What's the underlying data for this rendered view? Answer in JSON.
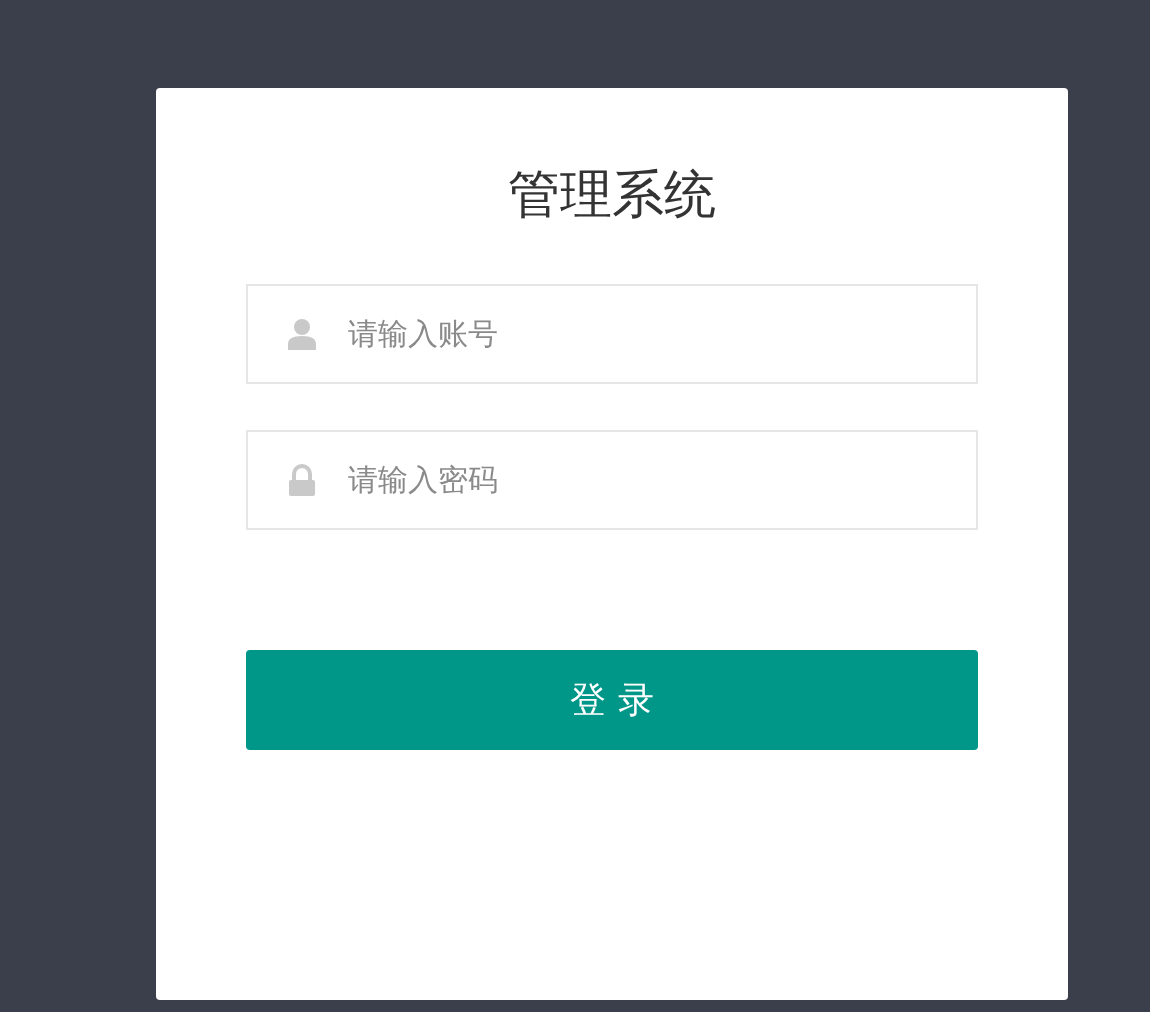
{
  "title": "管理系统",
  "fields": [
    {
      "kind": "user",
      "placeholder": "请输入账号"
    },
    {
      "kind": "password",
      "placeholder": "请输入密码"
    }
  ],
  "button": "登 录"
}
